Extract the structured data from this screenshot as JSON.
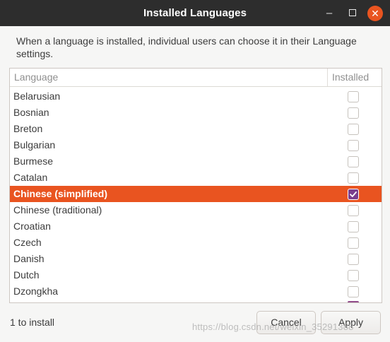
{
  "window": {
    "title": "Installed Languages",
    "controls": [
      "minimize-icon",
      "maximize-icon",
      "close-icon"
    ]
  },
  "description": "When a language is installed, individual users can choose it in their Language settings.",
  "list": {
    "columns": [
      "Language",
      "Installed"
    ],
    "rows": [
      {
        "label": "Belarusian",
        "installed": false,
        "selected": false
      },
      {
        "label": "Bosnian",
        "installed": false,
        "selected": false
      },
      {
        "label": "Breton",
        "installed": false,
        "selected": false
      },
      {
        "label": "Bulgarian",
        "installed": false,
        "selected": false
      },
      {
        "label": "Burmese",
        "installed": false,
        "selected": false
      },
      {
        "label": "Catalan",
        "installed": false,
        "selected": false
      },
      {
        "label": "Chinese (simplified)",
        "installed": true,
        "selected": true
      },
      {
        "label": "Chinese (traditional)",
        "installed": false,
        "selected": false
      },
      {
        "label": "Croatian",
        "installed": false,
        "selected": false
      },
      {
        "label": "Czech",
        "installed": false,
        "selected": false
      },
      {
        "label": "Danish",
        "installed": false,
        "selected": false
      },
      {
        "label": "Dutch",
        "installed": false,
        "selected": false
      },
      {
        "label": "Dzongkha",
        "installed": false,
        "selected": false
      }
    ]
  },
  "footer": {
    "status": "1 to install",
    "cancel_label": "Cancel",
    "apply_label": "Apply"
  },
  "watermark": "https://blog.csdn.net/weixin_35291388",
  "colors": {
    "titlebar": "#2d2d2d",
    "selection": "#e95420",
    "checked": "#7a3d8d"
  }
}
